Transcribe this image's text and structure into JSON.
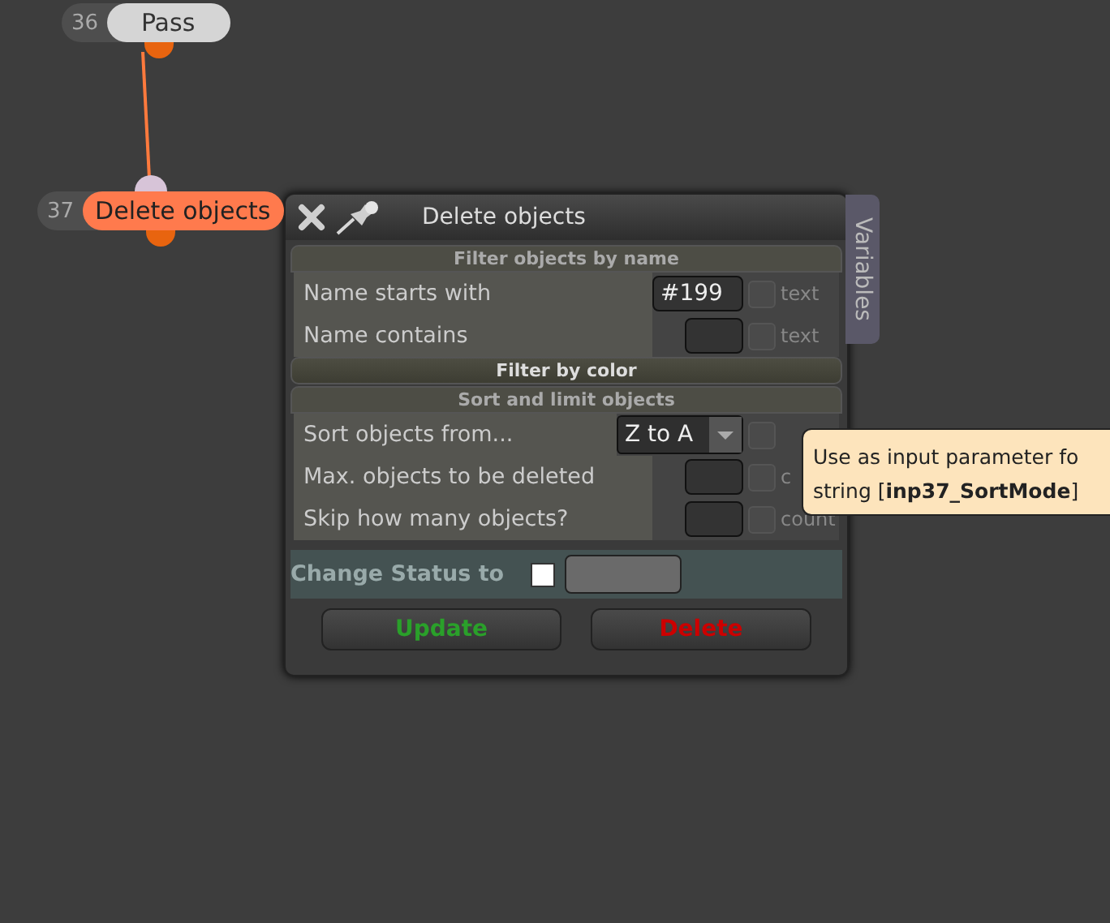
{
  "nodes": [
    {
      "number": "36",
      "label": "Pass",
      "selected": false
    },
    {
      "number": "37",
      "label": "Delete objects",
      "selected": true
    }
  ],
  "dialog": {
    "title": "Delete objects",
    "side_tab": "Variables",
    "sections": [
      {
        "title": "Filter objects by name",
        "kind": "rows",
        "rows": [
          {
            "label": "Name starts with",
            "kind": "input",
            "value": "#199",
            "suffix": "text",
            "checked": false
          },
          {
            "label": "Name contains",
            "kind": "input",
            "value": "",
            "suffix": "text",
            "checked": false
          }
        ]
      },
      {
        "title": "Filter by color",
        "kind": "header"
      },
      {
        "title": "Sort and limit objects",
        "kind": "rows",
        "rows": [
          {
            "label": "Sort objects from...",
            "kind": "dropdown",
            "value": "Z to A",
            "suffix": "",
            "checked": false
          },
          {
            "label": "Max. objects to be deleted",
            "kind": "input",
            "value": "",
            "suffix": "c",
            "checked": false
          },
          {
            "label": "Skip how many objects?",
            "kind": "input",
            "value": "",
            "suffix": "count",
            "checked": false
          }
        ]
      }
    ],
    "status": {
      "label": "Change Status to",
      "checked": false
    },
    "buttons": [
      {
        "label": "Update",
        "kind": "confirm"
      },
      {
        "label": "Delete",
        "kind": "danger"
      }
    ]
  },
  "tooltip": {
    "lines": [
      "Use as input parameter fo",
      "string [**inp37_SortMode**]"
    ]
  }
}
